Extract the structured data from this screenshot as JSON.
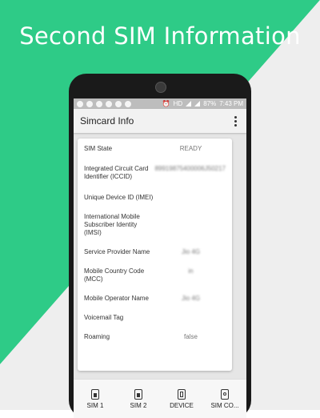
{
  "headline": "Second SIM Information",
  "status_bar": {
    "battery": "87%",
    "time": "7:43 PM",
    "network": "HD"
  },
  "app_bar": {
    "title": "Simcard Info"
  },
  "rows": [
    {
      "label": "SIM State",
      "value": "READY"
    },
    {
      "label": "Integrated Circuit Card Identifier (ICCID)",
      "value": "89919875400006J50217"
    },
    {
      "label": "Unique Device ID (IMEI)",
      "value": ""
    },
    {
      "label": "International Mobile Subscriber Identity (IMSI)",
      "value": ""
    },
    {
      "label": "Service Provider Name",
      "value": "Jio 4G"
    },
    {
      "label": "Mobile Country Code (MCC)",
      "value": "in"
    },
    {
      "label": "Mobile Operator Name",
      "value": "Jio 4G"
    },
    {
      "label": "Voicemail Tag",
      "value": ""
    },
    {
      "label": "Roaming",
      "value": "false"
    }
  ],
  "nav": [
    {
      "label": "SIM 1",
      "icon": "sim-icon"
    },
    {
      "label": "SIM 2",
      "icon": "sim-icon"
    },
    {
      "label": "DEVICE",
      "icon": "device-icon"
    },
    {
      "label": "SIM CO...",
      "icon": "contacts-icon"
    }
  ],
  "colors": {
    "accent": "#2ecb87",
    "background_lower": "#eeeeee"
  }
}
